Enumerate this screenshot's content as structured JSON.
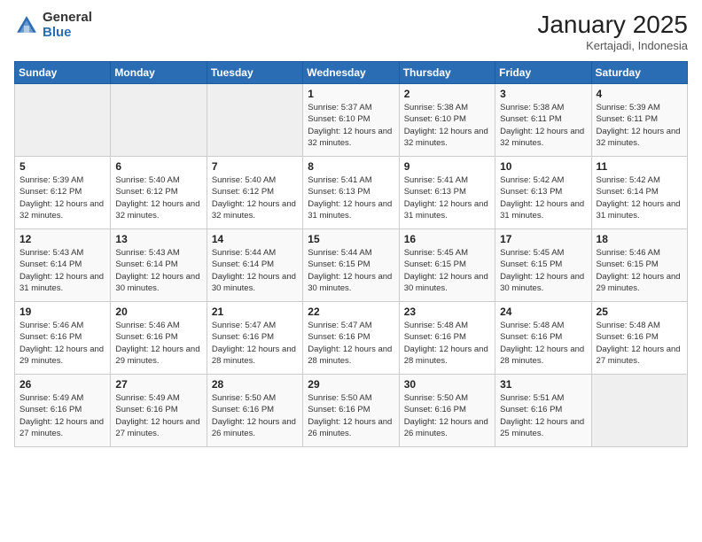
{
  "logo": {
    "general": "General",
    "blue": "Blue"
  },
  "header": {
    "title": "January 2025",
    "subtitle": "Kertajadi, Indonesia"
  },
  "days_of_week": [
    "Sunday",
    "Monday",
    "Tuesday",
    "Wednesday",
    "Thursday",
    "Friday",
    "Saturday"
  ],
  "weeks": [
    [
      {
        "day": "",
        "info": ""
      },
      {
        "day": "",
        "info": ""
      },
      {
        "day": "",
        "info": ""
      },
      {
        "day": "1",
        "info": "Sunrise: 5:37 AM\nSunset: 6:10 PM\nDaylight: 12 hours\nand 32 minutes."
      },
      {
        "day": "2",
        "info": "Sunrise: 5:38 AM\nSunset: 6:10 PM\nDaylight: 12 hours\nand 32 minutes."
      },
      {
        "day": "3",
        "info": "Sunrise: 5:38 AM\nSunset: 6:11 PM\nDaylight: 12 hours\nand 32 minutes."
      },
      {
        "day": "4",
        "info": "Sunrise: 5:39 AM\nSunset: 6:11 PM\nDaylight: 12 hours\nand 32 minutes."
      }
    ],
    [
      {
        "day": "5",
        "info": "Sunrise: 5:39 AM\nSunset: 6:12 PM\nDaylight: 12 hours\nand 32 minutes."
      },
      {
        "day": "6",
        "info": "Sunrise: 5:40 AM\nSunset: 6:12 PM\nDaylight: 12 hours\nand 32 minutes."
      },
      {
        "day": "7",
        "info": "Sunrise: 5:40 AM\nSunset: 6:12 PM\nDaylight: 12 hours\nand 32 minutes."
      },
      {
        "day": "8",
        "info": "Sunrise: 5:41 AM\nSunset: 6:13 PM\nDaylight: 12 hours\nand 31 minutes."
      },
      {
        "day": "9",
        "info": "Sunrise: 5:41 AM\nSunset: 6:13 PM\nDaylight: 12 hours\nand 31 minutes."
      },
      {
        "day": "10",
        "info": "Sunrise: 5:42 AM\nSunset: 6:13 PM\nDaylight: 12 hours\nand 31 minutes."
      },
      {
        "day": "11",
        "info": "Sunrise: 5:42 AM\nSunset: 6:14 PM\nDaylight: 12 hours\nand 31 minutes."
      }
    ],
    [
      {
        "day": "12",
        "info": "Sunrise: 5:43 AM\nSunset: 6:14 PM\nDaylight: 12 hours\nand 31 minutes."
      },
      {
        "day": "13",
        "info": "Sunrise: 5:43 AM\nSunset: 6:14 PM\nDaylight: 12 hours\nand 30 minutes."
      },
      {
        "day": "14",
        "info": "Sunrise: 5:44 AM\nSunset: 6:14 PM\nDaylight: 12 hours\nand 30 minutes."
      },
      {
        "day": "15",
        "info": "Sunrise: 5:44 AM\nSunset: 6:15 PM\nDaylight: 12 hours\nand 30 minutes."
      },
      {
        "day": "16",
        "info": "Sunrise: 5:45 AM\nSunset: 6:15 PM\nDaylight: 12 hours\nand 30 minutes."
      },
      {
        "day": "17",
        "info": "Sunrise: 5:45 AM\nSunset: 6:15 PM\nDaylight: 12 hours\nand 30 minutes."
      },
      {
        "day": "18",
        "info": "Sunrise: 5:46 AM\nSunset: 6:15 PM\nDaylight: 12 hours\nand 29 minutes."
      }
    ],
    [
      {
        "day": "19",
        "info": "Sunrise: 5:46 AM\nSunset: 6:16 PM\nDaylight: 12 hours\nand 29 minutes."
      },
      {
        "day": "20",
        "info": "Sunrise: 5:46 AM\nSunset: 6:16 PM\nDaylight: 12 hours\nand 29 minutes."
      },
      {
        "day": "21",
        "info": "Sunrise: 5:47 AM\nSunset: 6:16 PM\nDaylight: 12 hours\nand 28 minutes."
      },
      {
        "day": "22",
        "info": "Sunrise: 5:47 AM\nSunset: 6:16 PM\nDaylight: 12 hours\nand 28 minutes."
      },
      {
        "day": "23",
        "info": "Sunrise: 5:48 AM\nSunset: 6:16 PM\nDaylight: 12 hours\nand 28 minutes."
      },
      {
        "day": "24",
        "info": "Sunrise: 5:48 AM\nSunset: 6:16 PM\nDaylight: 12 hours\nand 28 minutes."
      },
      {
        "day": "25",
        "info": "Sunrise: 5:48 AM\nSunset: 6:16 PM\nDaylight: 12 hours\nand 27 minutes."
      }
    ],
    [
      {
        "day": "26",
        "info": "Sunrise: 5:49 AM\nSunset: 6:16 PM\nDaylight: 12 hours\nand 27 minutes."
      },
      {
        "day": "27",
        "info": "Sunrise: 5:49 AM\nSunset: 6:16 PM\nDaylight: 12 hours\nand 27 minutes."
      },
      {
        "day": "28",
        "info": "Sunrise: 5:50 AM\nSunset: 6:16 PM\nDaylight: 12 hours\nand 26 minutes."
      },
      {
        "day": "29",
        "info": "Sunrise: 5:50 AM\nSunset: 6:16 PM\nDaylight: 12 hours\nand 26 minutes."
      },
      {
        "day": "30",
        "info": "Sunrise: 5:50 AM\nSunset: 6:16 PM\nDaylight: 12 hours\nand 26 minutes."
      },
      {
        "day": "31",
        "info": "Sunrise: 5:51 AM\nSunset: 6:16 PM\nDaylight: 12 hours\nand 25 minutes."
      },
      {
        "day": "",
        "info": ""
      }
    ]
  ]
}
